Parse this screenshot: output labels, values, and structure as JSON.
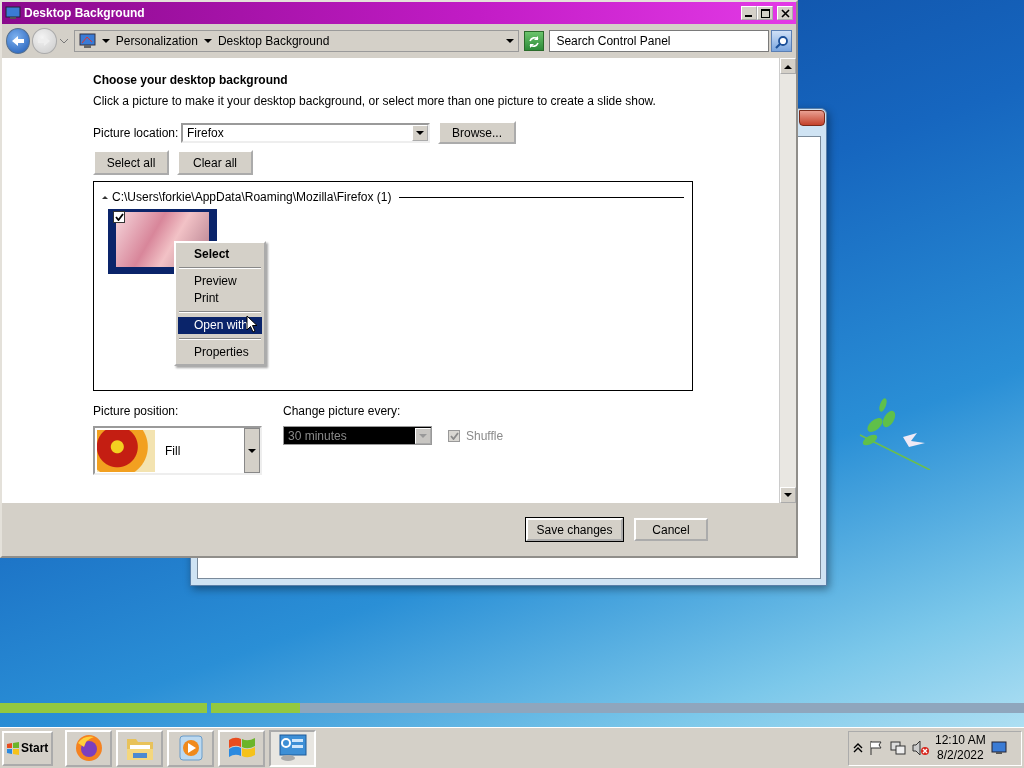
{
  "window": {
    "title": "Desktop Background"
  },
  "address_bar": {
    "breadcrumbs": [
      "Personalization",
      "Desktop Background"
    ]
  },
  "search": {
    "placeholder": "Search Control Panel"
  },
  "heading": "Choose your desktop background",
  "description": "Click a picture to make it your desktop background, or select more than one picture to create a slide show.",
  "picture_location": {
    "label": "Picture location:",
    "value": "Firefox"
  },
  "browse_button": "Browse...",
  "select_buttons": [
    "Select all",
    "Clear all"
  ],
  "gallery": {
    "group_label": "C:\\Users\\forkie\\AppData\\Roaming\\Mozilla\\Firefox (1)",
    "expanded": true,
    "pictures": [
      {
        "checked": true,
        "selected": true
      }
    ]
  },
  "context_menu": [
    {
      "kind": "item",
      "label": "Select",
      "default": true,
      "selected": false
    },
    {
      "kind": "separator"
    },
    {
      "kind": "item",
      "label": "Preview",
      "default": false,
      "selected": false
    },
    {
      "kind": "item",
      "label": "Print",
      "default": false,
      "selected": false
    },
    {
      "kind": "separator"
    },
    {
      "kind": "item",
      "label": "Open with",
      "default": false,
      "selected": true
    },
    {
      "kind": "separator"
    },
    {
      "kind": "item",
      "label": "Properties",
      "default": false,
      "selected": false
    }
  ],
  "picture_position": {
    "label": "Picture position:",
    "value": "Fill"
  },
  "change_picture": {
    "label": "Change picture every:",
    "value": "30 minutes",
    "disabled": true
  },
  "shuffle": {
    "label": "Shuffle",
    "checked": true,
    "disabled": true
  },
  "footer_buttons": [
    {
      "label": "Save changes",
      "default": true
    },
    {
      "label": "Cancel",
      "default": false
    }
  ],
  "progress_bars": [
    {
      "level": 1
    },
    {
      "level": 0.11
    }
  ],
  "taskbar": {
    "start": "Start",
    "apps": [
      {
        "kind": "browser",
        "selected": false
      },
      {
        "kind": "folder",
        "selected": false
      },
      {
        "kind": "media",
        "selected": false
      },
      {
        "kind": "windows",
        "selected": false
      },
      {
        "kind": "control-panel",
        "selected": true
      }
    ],
    "clock": {
      "time": "12:10 AM",
      "date": "8/2/2022"
    }
  }
}
